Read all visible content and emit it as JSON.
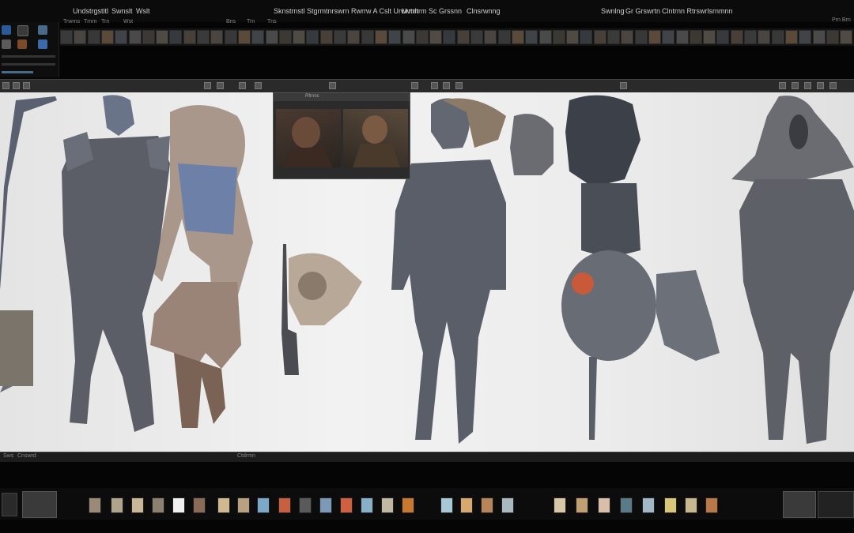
{
  "menubar": {
    "items": [
      "Undstrgstitl",
      "Swnslt",
      "Wslt",
      "Sknstrnstl Stgrmtnrswrn Rwrrw A Cslt Urwrmn",
      "Uvtrltrm Sc Grssnn",
      "Clnsrwnng",
      "Swnlng",
      "Gr Grswrtn",
      "Clntrnn Rtrswrlsrnmnn",
      "Prn Brn"
    ]
  },
  "subtabs": [
    "Trwrns",
    "Tmrn",
    "Trn",
    "Wst",
    "Bns",
    "Trn",
    "Tns"
  ],
  "status": {
    "left": "Sws",
    "mid": "Cnswrd",
    "center": "Ctdrmn"
  },
  "refwin": {
    "title": "Rfrnnc"
  },
  "colors": {
    "accent": "#4a8fd6",
    "viewport_bg": "#ededed",
    "ui_dark": "#0b0b0b"
  },
  "icons": [
    "app-icon",
    "brush-icon",
    "sculpt-icon",
    "layer-icon",
    "light-icon",
    "camera-icon"
  ],
  "swatches": [
    "#9a8a78",
    "#b0a48c",
    "#c8b898",
    "#8c8070",
    "#f0f0f0",
    "#8a6a58",
    "#d0b890",
    "#b8a080",
    "#7ea8c8",
    "#c86040",
    "#5a5a5a",
    "#7a9ab8",
    "#d06040",
    "#8ab0c8",
    "#c0b8a0",
    "#c87830",
    "#a8c8d8",
    "#d8a870",
    "#b8855a",
    "#aab8c0",
    "#d8c8a8",
    "#c0a070",
    "#d8c0a8",
    "#5a7a88",
    "#a0b8c8",
    "#d8c878",
    "#c8b890",
    "#b87848"
  ]
}
